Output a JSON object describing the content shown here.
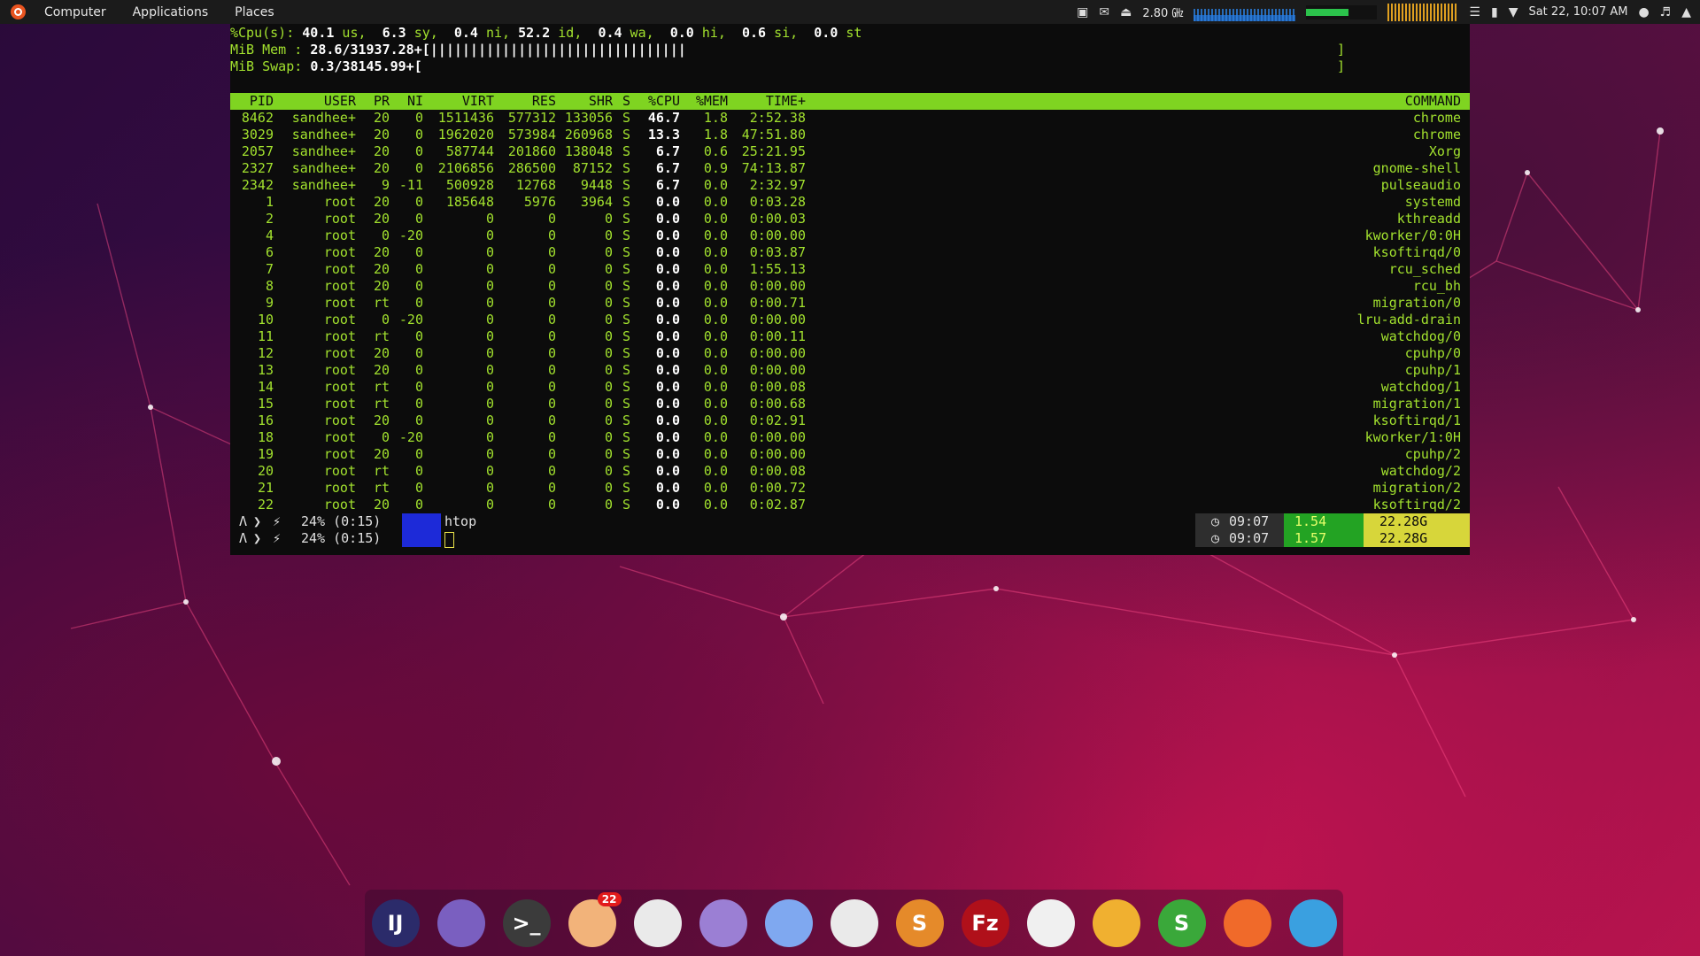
{
  "top_panel": {
    "menu": [
      "Computer",
      "Applications",
      "Places"
    ],
    "cpu_freq": "2.80 ㎓",
    "clock": "Sat 22, 10:07 AM",
    "mem_usage_fraction": 0.6
  },
  "summary": {
    "cpu": {
      "label": "%Cpu(s):",
      "us": "40.1",
      "sy": "6.3",
      "ni": "0.4",
      "id": "52.2",
      "wa": "0.4",
      "hi": "0.0",
      "si": "0.6",
      "st": "0.0"
    },
    "mem": {
      "label": "MiB Mem :",
      "value": "28.6/31937.28+[",
      "bar": "||||||||||||||||||||||||||||||||",
      "end": "]"
    },
    "swap": {
      "label": "MiB Swap:",
      "value": "0.3/38145.99+[",
      "end": "]"
    }
  },
  "process_table": {
    "columns": [
      "PID",
      "USER",
      "PR",
      "NI",
      "VIRT",
      "RES",
      "SHR",
      "S",
      "%CPU",
      "%MEM",
      "TIME+",
      "COMMAND"
    ],
    "rows": [
      [
        "8462",
        "sandhee+",
        "20",
        "0",
        "1511436",
        "577312",
        "133056",
        "S",
        "46.7",
        "1.8",
        "2:52.38",
        "chrome"
      ],
      [
        "3029",
        "sandhee+",
        "20",
        "0",
        "1962020",
        "573984",
        "260968",
        "S",
        "13.3",
        "1.8",
        "47:51.80",
        "chrome"
      ],
      [
        "2057",
        "sandhee+",
        "20",
        "0",
        "587744",
        "201860",
        "138048",
        "S",
        "6.7",
        "0.6",
        "25:21.95",
        "Xorg"
      ],
      [
        "2327",
        "sandhee+",
        "20",
        "0",
        "2106856",
        "286500",
        "87152",
        "S",
        "6.7",
        "0.9",
        "74:13.87",
        "gnome-shell"
      ],
      [
        "2342",
        "sandhee+",
        "9",
        "-11",
        "500928",
        "12768",
        "9448",
        "S",
        "6.7",
        "0.0",
        "2:32.97",
        "pulseaudio"
      ],
      [
        "1",
        "root",
        "20",
        "0",
        "185648",
        "5976",
        "3964",
        "S",
        "0.0",
        "0.0",
        "0:03.28",
        "systemd"
      ],
      [
        "2",
        "root",
        "20",
        "0",
        "0",
        "0",
        "0",
        "S",
        "0.0",
        "0.0",
        "0:00.03",
        "kthreadd"
      ],
      [
        "4",
        "root",
        "0",
        "-20",
        "0",
        "0",
        "0",
        "S",
        "0.0",
        "0.0",
        "0:00.00",
        "kworker/0:0H"
      ],
      [
        "6",
        "root",
        "20",
        "0",
        "0",
        "0",
        "0",
        "S",
        "0.0",
        "0.0",
        "0:03.87",
        "ksoftirqd/0"
      ],
      [
        "7",
        "root",
        "20",
        "0",
        "0",
        "0",
        "0",
        "S",
        "0.0",
        "0.0",
        "1:55.13",
        "rcu_sched"
      ],
      [
        "8",
        "root",
        "20",
        "0",
        "0",
        "0",
        "0",
        "S",
        "0.0",
        "0.0",
        "0:00.00",
        "rcu_bh"
      ],
      [
        "9",
        "root",
        "rt",
        "0",
        "0",
        "0",
        "0",
        "S",
        "0.0",
        "0.0",
        "0:00.71",
        "migration/0"
      ],
      [
        "10",
        "root",
        "0",
        "-20",
        "0",
        "0",
        "0",
        "S",
        "0.0",
        "0.0",
        "0:00.00",
        "lru-add-drain"
      ],
      [
        "11",
        "root",
        "rt",
        "0",
        "0",
        "0",
        "0",
        "S",
        "0.0",
        "0.0",
        "0:00.11",
        "watchdog/0"
      ],
      [
        "12",
        "root",
        "20",
        "0",
        "0",
        "0",
        "0",
        "S",
        "0.0",
        "0.0",
        "0:00.00",
        "cpuhp/0"
      ],
      [
        "13",
        "root",
        "20",
        "0",
        "0",
        "0",
        "0",
        "S",
        "0.0",
        "0.0",
        "0:00.00",
        "cpuhp/1"
      ],
      [
        "14",
        "root",
        "rt",
        "0",
        "0",
        "0",
        "0",
        "S",
        "0.0",
        "0.0",
        "0:00.08",
        "watchdog/1"
      ],
      [
        "15",
        "root",
        "rt",
        "0",
        "0",
        "0",
        "0",
        "S",
        "0.0",
        "0.0",
        "0:00.68",
        "migration/1"
      ],
      [
        "16",
        "root",
        "20",
        "0",
        "0",
        "0",
        "0",
        "S",
        "0.0",
        "0.0",
        "0:02.91",
        "ksoftirqd/1"
      ],
      [
        "18",
        "root",
        "0",
        "-20",
        "0",
        "0",
        "0",
        "S",
        "0.0",
        "0.0",
        "0:00.00",
        "kworker/1:0H"
      ],
      [
        "19",
        "root",
        "20",
        "0",
        "0",
        "0",
        "0",
        "S",
        "0.0",
        "0.0",
        "0:00.00",
        "cpuhp/2"
      ],
      [
        "20",
        "root",
        "rt",
        "0",
        "0",
        "0",
        "0",
        "S",
        "0.0",
        "0.0",
        "0:00.08",
        "watchdog/2"
      ],
      [
        "21",
        "root",
        "rt",
        "0",
        "0",
        "0",
        "0",
        "S",
        "0.0",
        "0.0",
        "0:00.72",
        "migration/2"
      ],
      [
        "22",
        "root",
        "20",
        "0",
        "0",
        "0",
        "0",
        "S",
        "0.0",
        "0.0",
        "0:02.87",
        "ksoftirqd/2"
      ]
    ]
  },
  "prompt": {
    "battery_1": "24% (0:15)",
    "battery_2": "24% (0:15)",
    "command": "htop",
    "right_1": {
      "clock": "09:07",
      "load": "1.54",
      "mem": "22.28G"
    },
    "right_2": {
      "clock": "09:07",
      "load": "1.57",
      "mem": "22.28G"
    }
  },
  "dock": {
    "apps": [
      {
        "icon": "intellij-icon",
        "label": "IJ",
        "color": "#2b2b6a"
      },
      {
        "icon": "files-icon",
        "label": "",
        "color": "#7a5fc0"
      },
      {
        "icon": "terminal-icon",
        "label": ">_",
        "color": "#3b3b3b"
      },
      {
        "icon": "mail-icon",
        "label": "",
        "color": "#f2b37a",
        "badge": "22"
      },
      {
        "icon": "shutter-icon",
        "label": "",
        "color": "#eaeaea"
      },
      {
        "icon": "text-editor-icon",
        "label": "",
        "color": "#9b7fd4"
      },
      {
        "icon": "remote-desktop-icon",
        "label": "",
        "color": "#7fa8f0"
      },
      {
        "icon": "chrome-icon",
        "label": "",
        "color": "#eaeaea"
      },
      {
        "icon": "sublime-icon",
        "label": "S",
        "color": "#e58a2a"
      },
      {
        "icon": "filezilla-icon",
        "label": "Fz",
        "color": "#b0101a"
      },
      {
        "icon": "system-monitor-icon",
        "label": "",
        "color": "#f0f0f0"
      },
      {
        "icon": "mysql-workbench-icon",
        "label": "",
        "color": "#f0b030"
      },
      {
        "icon": "sublime-merge-icon",
        "label": "S",
        "color": "#3aa83a"
      },
      {
        "icon": "postman-icon",
        "label": "",
        "color": "#f06a2a"
      },
      {
        "icon": "telegram-icon",
        "label": "",
        "color": "#3aa0e0"
      }
    ]
  }
}
